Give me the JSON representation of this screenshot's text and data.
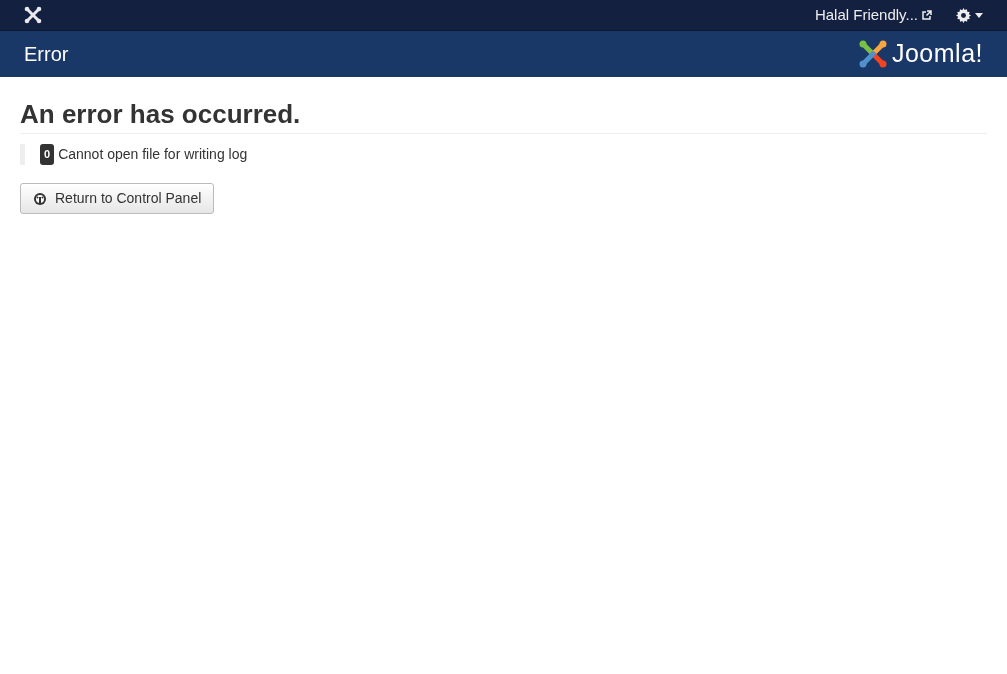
{
  "top_bar": {
    "site_link": "Halal Friendly...",
    "settings_menu": {
      "expanded": false
    }
  },
  "header": {
    "title": "Error",
    "logo_text": "Joomla!"
  },
  "error": {
    "heading": "An error has occurred.",
    "code": "0",
    "message": "Cannot open file for writing log"
  },
  "button": {
    "label": "Return to Control Panel"
  }
}
